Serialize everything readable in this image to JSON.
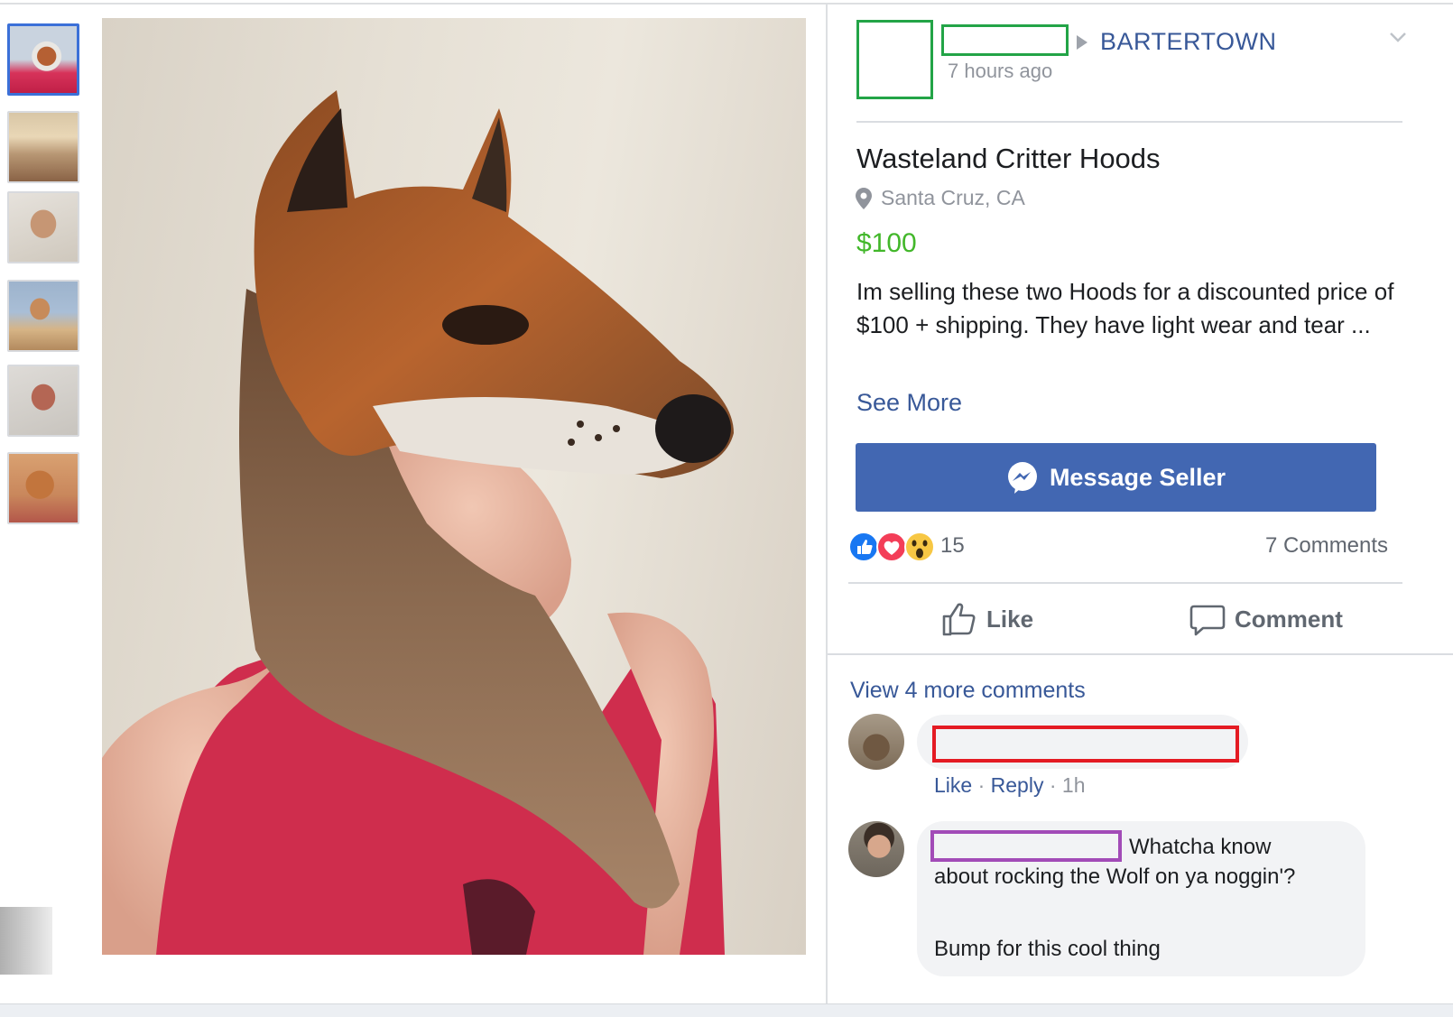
{
  "post": {
    "group_name": "BARTERTOWN",
    "timestamp": "7 hours ago"
  },
  "listing": {
    "title": "Wasteland Critter Hoods",
    "location": "Santa Cruz, CA",
    "price": "$100",
    "description": "Im selling these two Hoods for a discounted price of $100 + shipping. They have light wear and tear ...",
    "see_more": "See More",
    "message_button": "Message Seller"
  },
  "engagement": {
    "reaction_icons": [
      "like-reaction-icon",
      "love-reaction-icon",
      "wow-reaction-icon"
    ],
    "reaction_count": "15",
    "comment_count": "7 Comments",
    "like_label": "Like",
    "comment_label": "Comment"
  },
  "comments": {
    "view_more": "View 4 more comments",
    "items": [
      {
        "actions": {
          "like": "Like",
          "reply": "Reply",
          "time": "1h"
        }
      },
      {
        "text_inline": "Whatcha know",
        "text_rest": "about rocking the Wolf on ya noggin'?",
        "text_followup": "Bump for this cool thing"
      }
    ]
  },
  "colors": {
    "brand_blue": "#4267b2",
    "link_blue": "#385898",
    "price_green": "#42b72a",
    "redaction_green": "#23a447",
    "redaction_red": "#e41b23",
    "redaction_purple": "#a24bb7"
  }
}
